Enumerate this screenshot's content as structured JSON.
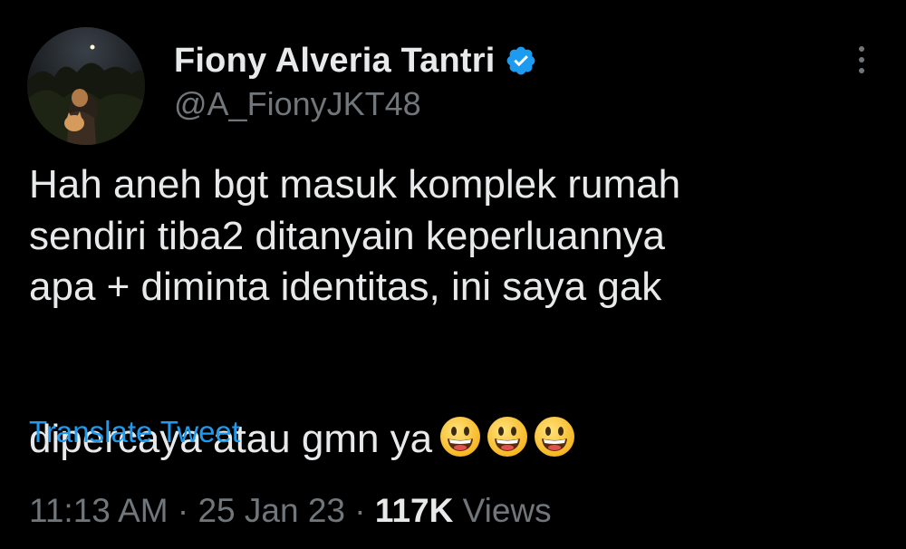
{
  "author": {
    "display_name": "Fiony Alveria Tantri",
    "handle": "@A_FionyJKT48",
    "verified": true,
    "verified_color": "#1d9bf0"
  },
  "tweet": {
    "text": "Hah aneh bgt masuk komplek rumah\nsendiri tiba2 ditanyain keperluannya\napa + diminta identitas, ini saya gak\ndipercaya atau gmn ya",
    "emojis": [
      "grinning-face",
      "grinning-face",
      "grinning-face"
    ]
  },
  "translate_label": "Translate Tweet",
  "meta": {
    "time": "11:13 AM",
    "separator": "·",
    "date": "25 Jan 23",
    "views_count": "117K",
    "views_label": "Views"
  },
  "colors": {
    "background": "#000000",
    "text_primary": "#e7e9ea",
    "text_secondary": "#71767b",
    "link": "#1d9bf0"
  },
  "icons": {
    "more": "more-vertical-icon",
    "verified": "verified-badge-icon"
  }
}
